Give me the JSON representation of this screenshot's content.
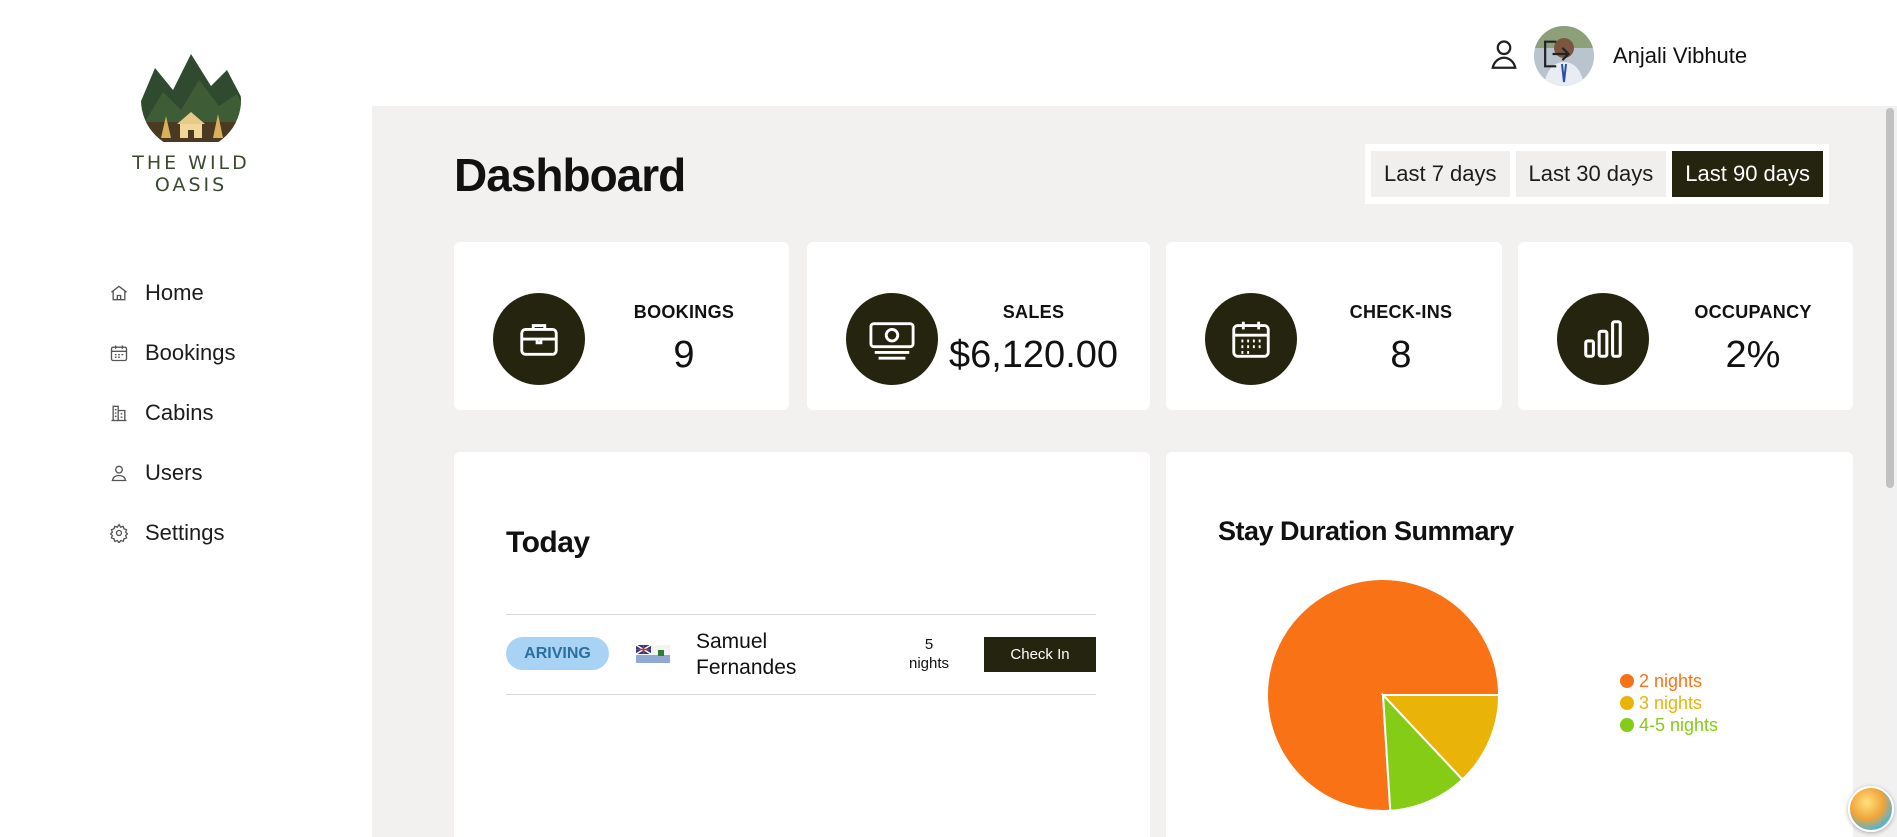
{
  "brand": {
    "name": "THE WILD OASIS",
    "logo_icon": "mountain-cabin-logo"
  },
  "sidebar": {
    "items": [
      {
        "label": "Home",
        "icon": "home-icon"
      },
      {
        "label": "Bookings",
        "icon": "calendar-icon"
      },
      {
        "label": "Cabins",
        "icon": "cabin-icon"
      },
      {
        "label": "Users",
        "icon": "user-icon"
      },
      {
        "label": "Settings",
        "icon": "gear-icon"
      }
    ]
  },
  "header": {
    "user_name": "Anjali Vibhute",
    "icons": [
      "user-icon",
      "logout-icon"
    ]
  },
  "dashboard": {
    "title": "Dashboard",
    "filters": [
      {
        "label": "Last 7 days",
        "active": false
      },
      {
        "label": "Last 30 days",
        "active": false
      },
      {
        "label": "Last 90 days",
        "active": true
      }
    ],
    "stats": [
      {
        "label": "BOOKINGS",
        "value": "9",
        "icon": "briefcase-icon"
      },
      {
        "label": "SALES",
        "value": "$6,120.00",
        "icon": "banknotes-icon"
      },
      {
        "label": "CHECK-INS",
        "value": "8",
        "icon": "calendar-days-icon"
      },
      {
        "label": "OCCUPANCY",
        "value": "2%",
        "icon": "chart-bar-icon"
      }
    ]
  },
  "today": {
    "title": "Today",
    "rows": [
      {
        "status": "ARIVING",
        "flag": "flag-icon",
        "guest": "Samuel Fernandes",
        "nights_count": "5",
        "nights_unit": "nights",
        "action": "Check In"
      }
    ]
  },
  "chart_data": {
    "type": "pie",
    "title": "Stay Duration Summary",
    "categories": [
      "2 nights",
      "3 nights",
      "4-5 nights"
    ],
    "values": [
      76,
      13,
      11
    ],
    "colors": [
      "#f97316",
      "#eab308",
      "#84cc16"
    ],
    "legend_position": "right"
  }
}
